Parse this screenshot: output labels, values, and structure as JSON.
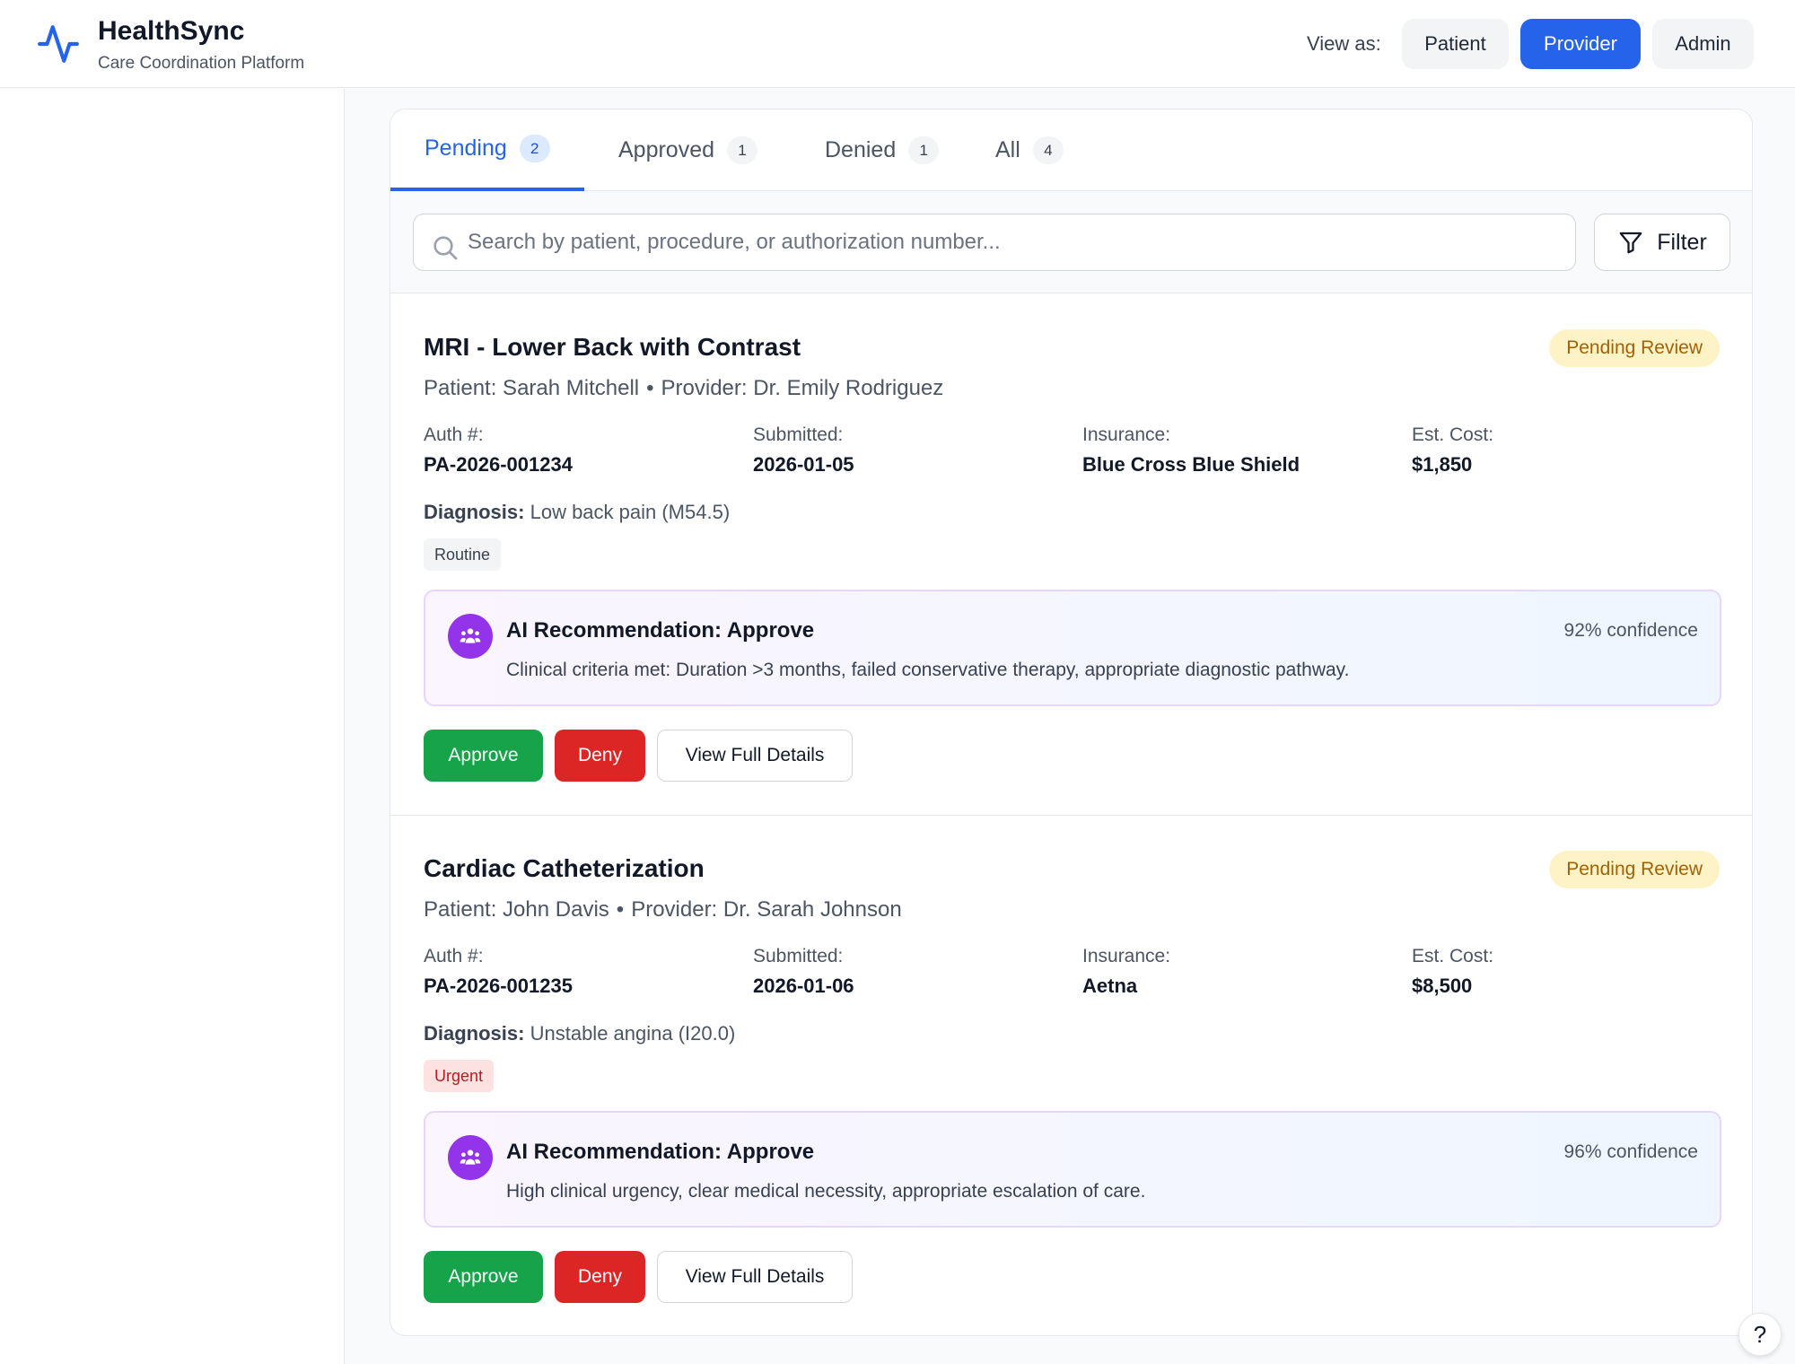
{
  "header": {
    "app_title": "HealthSync",
    "app_subtitle": "Care Coordination Platform",
    "view_as_label": "View as:",
    "roles": [
      "Patient",
      "Provider",
      "Admin"
    ],
    "active_role": "Provider"
  },
  "tabs": [
    {
      "label": "Pending",
      "count": "2",
      "active": true
    },
    {
      "label": "Approved",
      "count": "1",
      "active": false
    },
    {
      "label": "Denied",
      "count": "1",
      "active": false
    },
    {
      "label": "All",
      "count": "4",
      "active": false
    }
  ],
  "search": {
    "placeholder": "Search by patient, procedure, or authorization number...",
    "value": ""
  },
  "filter_label": "Filter",
  "field_labels": {
    "auth": "Auth #:",
    "submitted": "Submitted:",
    "insurance": "Insurance:",
    "cost": "Est. Cost:",
    "diagnosis": "Diagnosis:"
  },
  "requests": [
    {
      "procedure": "MRI - Lower Back with Contrast",
      "status": "Pending Review",
      "patient": "Patient: Sarah Mitchell",
      "provider": "Provider: Dr. Emily Rodriguez",
      "auth_number": "PA-2026-001234",
      "submitted": "2026-01-05",
      "insurance": "Blue Cross Blue Shield",
      "est_cost": "$1,850",
      "diagnosis": "Low back pain (M54.5)",
      "priority": "Routine",
      "ai": {
        "title": "AI Recommendation: Approve",
        "confidence": "92% confidence",
        "rationale": "Clinical criteria met: Duration >3 months, failed conservative therapy, appropriate diagnostic pathway."
      }
    },
    {
      "procedure": "Cardiac Catheterization",
      "status": "Pending Review",
      "patient": "Patient: John Davis",
      "provider": "Provider: Dr. Sarah Johnson",
      "auth_number": "PA-2026-001235",
      "submitted": "2026-01-06",
      "insurance": "Aetna",
      "est_cost": "$8,500",
      "diagnosis": "Unstable angina (I20.0)",
      "priority": "Urgent",
      "ai": {
        "title": "AI Recommendation: Approve",
        "confidence": "96% confidence",
        "rationale": "High clinical urgency, clear medical necessity, appropriate escalation of care."
      }
    }
  ],
  "actions": {
    "approve": "Approve",
    "deny": "Deny",
    "details": "View Full Details"
  },
  "help_label": "?",
  "colors": {
    "primary": "#2563eb",
    "approve": "#16a34a",
    "deny": "#dc2626",
    "ai_accent": "#9333ea",
    "pending_badge_bg": "#fef3c7",
    "pending_badge_text": "#a16207"
  },
  "icons": {
    "logo": "activity-pulse-icon",
    "search": "search-icon",
    "filter": "filter-funnel-icon",
    "ai": "users-group-icon",
    "help": "question-mark-icon"
  }
}
